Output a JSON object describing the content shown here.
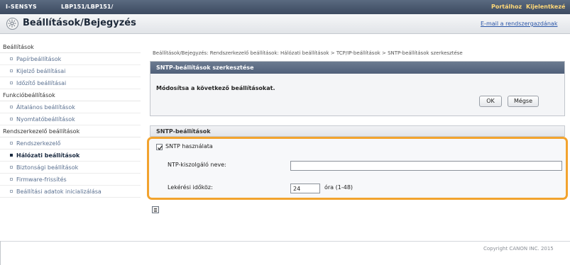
{
  "topbar": {
    "brand": "I-SENSYS",
    "model": "LBP151/LBP151/",
    "portal_link": "Portálhoz",
    "logout_link": "Kijelentkezé"
  },
  "header": {
    "title": "Beállítások/Bejegyzés",
    "mail_admin_link": "E-mail a rendszergazdának",
    "icon": "gear-icon"
  },
  "sidebar": {
    "sections": [
      {
        "label": "Beállítások",
        "items": [
          "Papírbeállítások",
          "Kijelző beállításai",
          "Időzítő beállításai"
        ]
      },
      {
        "label": "Funkcióbeállítások",
        "items": [
          "Általános beállítások",
          "Nyomtatóbeállítások"
        ]
      },
      {
        "label": "Rendszerkezelő beállítások",
        "items": [
          "Rendszerkezelő",
          "Hálózati beállítások",
          "Biztonsági beállítások",
          "Firmware-frissítés",
          "Beállítási adatok inicializálása"
        ]
      }
    ],
    "active_item": "Hálózati beállítások"
  },
  "main": {
    "breadcrumb": "Beállítások/Bejegyzés: Rendszerkezelő beállítások: Hálózati beállítások > TCP/IP-beállítások > SNTP-beállítások szerkesztése",
    "edit_box": {
      "title": "SNTP-beállítások szerkesztése",
      "message": "Módosítsa a következő beállításokat.",
      "ok_label": "OK",
      "cancel_label": "Mégse"
    },
    "section_title": "SNTP-beállítások",
    "use_sntp": {
      "label": "SNTP használata",
      "checked": true
    },
    "ntp_server": {
      "label": "NTP-kiszolgáló neve:",
      "value": ""
    },
    "polling": {
      "label": "Lekérési időköz:",
      "value": "24",
      "unit": "óra (1-48)"
    }
  },
  "footer": {
    "copyright": "Copyright CANON INC. 2015"
  },
  "colors": {
    "highlight": "#f2a32e",
    "topbar": "#4a5870",
    "link": "#2a56a8"
  }
}
